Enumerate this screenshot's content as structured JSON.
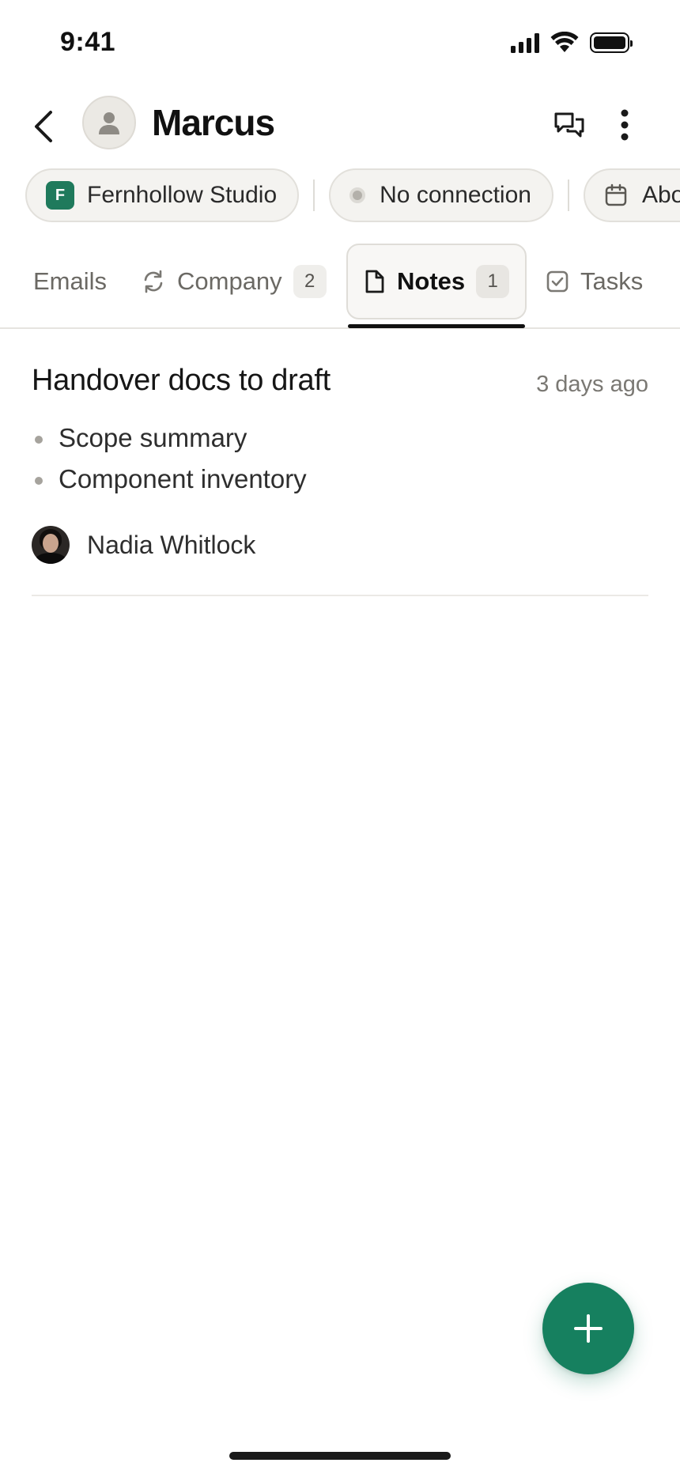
{
  "status_bar": {
    "time": "9:41"
  },
  "header": {
    "contact_name": "Marcus",
    "icons": [
      "back-chevron-icon",
      "person-icon",
      "chat-bubbles-icon",
      "more-vertical-icon"
    ]
  },
  "chips": [
    {
      "label": "Fernhollow Studio",
      "logo_letter": "F",
      "logo_color": "#1f7a5c"
    },
    {
      "label": "No connection",
      "icon": "status-dot-icon"
    },
    {
      "label": "Abo",
      "icon": "calendar-icon"
    }
  ],
  "tabs": [
    {
      "label": "Emails"
    },
    {
      "label": "Company",
      "count": "2",
      "icon": "sync-icon"
    },
    {
      "label": "Notes",
      "count": "1",
      "icon": "document-icon",
      "active": true
    },
    {
      "label": "Tasks",
      "icon": "checkbox-icon"
    }
  ],
  "note": {
    "title": "Handover docs to draft",
    "time": "3 days ago",
    "bullets": [
      "Scope summary",
      "Component inventory"
    ],
    "author": "Nadia Whitlock"
  },
  "fab": {
    "icon": "plus-icon",
    "color": "#16805f"
  }
}
